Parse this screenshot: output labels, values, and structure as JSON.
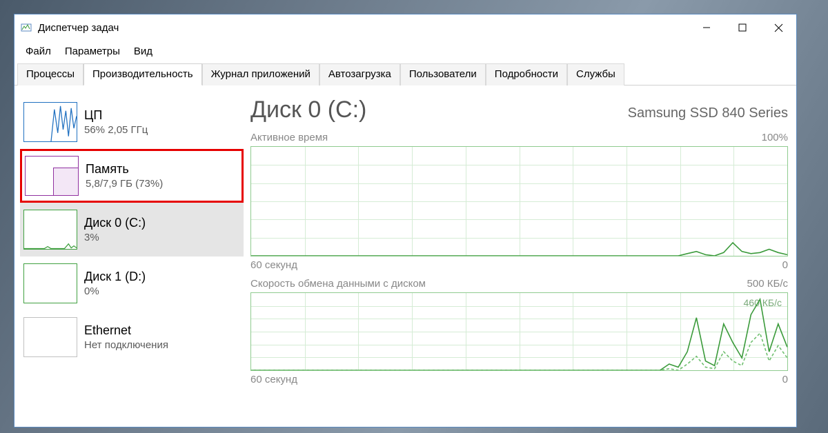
{
  "window": {
    "title": "Диспетчер задач"
  },
  "menu": {
    "file": "Файл",
    "options": "Параметры",
    "view": "Вид"
  },
  "tabs": {
    "processes": "Процессы",
    "performance": "Производительность",
    "app_history": "Журнал приложений",
    "startup": "Автозагрузка",
    "users": "Пользователи",
    "details": "Подробности",
    "services": "Службы"
  },
  "sidebar": {
    "cpu": {
      "title": "ЦП",
      "sub": "56%  2,05 ГГц"
    },
    "memory": {
      "title": "Память",
      "sub": "5,8/7,9 ГБ (73%)"
    },
    "disk0": {
      "title": "Диск 0 (C:)",
      "sub": "3%"
    },
    "disk1": {
      "title": "Диск 1 (D:)",
      "sub": "0%"
    },
    "ethernet": {
      "title": "Ethernet",
      "sub": "Нет подключения"
    }
  },
  "main": {
    "title": "Диск 0 (C:)",
    "subtitle": "Samsung SSD 840 Series",
    "chart1": {
      "label": "Активное время",
      "max": "100%",
      "xleft": "60 секунд",
      "xright": "0"
    },
    "chart2": {
      "label": "Скорость обмена данными с диском",
      "max": "500 КБ/с",
      "peak": "460 КБ/с",
      "xleft": "60 секунд",
      "xright": "0"
    }
  },
  "chart_data": [
    {
      "type": "line",
      "title": "Активное время",
      "ylabel": "%",
      "ylim": [
        0,
        100
      ],
      "xlabel": "секунд",
      "xlim": [
        60,
        0
      ],
      "series": [
        {
          "name": "active_time_pct",
          "values": [
            0,
            0,
            0,
            0,
            0,
            0,
            0,
            0,
            0,
            0,
            0,
            0,
            0,
            0,
            0,
            0,
            0,
            0,
            0,
            0,
            0,
            0,
            0,
            0,
            0,
            0,
            0,
            0,
            0,
            0,
            0,
            0,
            0,
            0,
            0,
            0,
            0,
            0,
            0,
            0,
            0,
            0,
            0,
            0,
            0,
            0,
            0,
            0,
            2,
            4,
            1,
            0,
            3,
            12,
            4,
            2,
            3,
            6,
            3,
            1
          ]
        }
      ]
    },
    {
      "type": "line",
      "title": "Скорость обмена данными с диском",
      "ylabel": "КБ/с",
      "ylim": [
        0,
        500
      ],
      "xlabel": "секунд",
      "xlim": [
        60,
        0
      ],
      "series": [
        {
          "name": "read_kbps",
          "values": [
            0,
            0,
            0,
            0,
            0,
            0,
            0,
            0,
            0,
            0,
            0,
            0,
            0,
            0,
            0,
            0,
            0,
            0,
            0,
            0,
            0,
            0,
            0,
            0,
            0,
            0,
            0,
            0,
            0,
            0,
            0,
            0,
            0,
            0,
            0,
            0,
            0,
            0,
            0,
            0,
            0,
            0,
            0,
            0,
            0,
            0,
            40,
            20,
            120,
            340,
            60,
            30,
            300,
            180,
            80,
            360,
            460,
            120,
            300,
            150
          ]
        },
        {
          "name": "write_kbps",
          "values": [
            0,
            0,
            0,
            0,
            0,
            0,
            0,
            0,
            0,
            0,
            0,
            0,
            0,
            0,
            0,
            0,
            0,
            0,
            0,
            0,
            0,
            0,
            0,
            0,
            0,
            0,
            0,
            0,
            0,
            0,
            0,
            0,
            0,
            0,
            0,
            0,
            0,
            0,
            0,
            0,
            0,
            0,
            0,
            0,
            0,
            0,
            10,
            0,
            40,
            90,
            20,
            10,
            120,
            60,
            30,
            180,
            240,
            60,
            160,
            80
          ]
        }
      ],
      "annotations": [
        {
          "text": "460 КБ/с"
        }
      ]
    }
  ]
}
